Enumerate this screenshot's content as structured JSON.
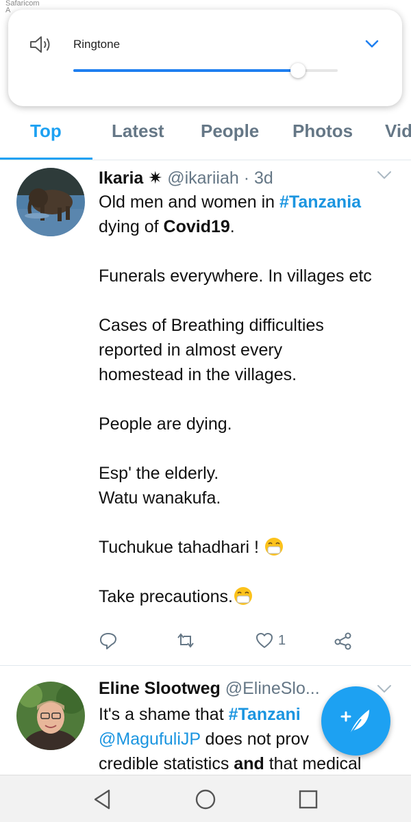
{
  "status_bar": {
    "carrier": "Safaricom",
    "carrier_line2": "A"
  },
  "volume_panel": {
    "label": "Ringtone",
    "level": 0.85,
    "speaker_icon": "speaker-icon",
    "expand_icon": "chevron-down-icon",
    "accent": "#1f7ff0"
  },
  "tabs": [
    {
      "label": "Top",
      "active": true
    },
    {
      "label": "Latest"
    },
    {
      "label": "People"
    },
    {
      "label": "Photos"
    },
    {
      "label": "Vid"
    }
  ],
  "tweet1": {
    "name": "Ikaria",
    "badge": "✷",
    "handle": "@ikariiah",
    "sep": "·",
    "age": "3d",
    "line1_pre": "Old men and women in ",
    "line1_tag": "#Tanzania",
    "line2_pre": "dying of ",
    "line2_bold": "Covid19",
    "line2_post": ".",
    "p2": "Funerals everywhere. In villages etc",
    "p3a": "Cases of Breathing difficulties",
    "p3b": "reported in almost every",
    "p3c": "homestead in the villages.",
    "p4": "People are dying.",
    "p5a": "Esp' the elderly.",
    "p5b": "Watu wanakufa.",
    "p6": "Tuchukue tahadhari ! ",
    "p7": "Take precautions.",
    "likes": "1",
    "icons": [
      "reply-icon",
      "retweet-icon",
      "heart-icon",
      "share-icon"
    ]
  },
  "tweet2": {
    "name": "Eline Slootweg",
    "handle": "@ElineSlo...",
    "l1_pre": "It's a shame that ",
    "l1_tag": "#Tanzani",
    "l2_mention": "@MagufuliJP",
    "l2_post": " does not prov",
    "l3_pre": "credible statistics ",
    "l3_bold": "and",
    "l3_post": " that medical"
  },
  "fab": {
    "icon": "compose-feather-icon",
    "color": "#1da1f2"
  },
  "nav_bar": {
    "icons": [
      "back-icon",
      "home-icon",
      "recents-icon"
    ]
  }
}
